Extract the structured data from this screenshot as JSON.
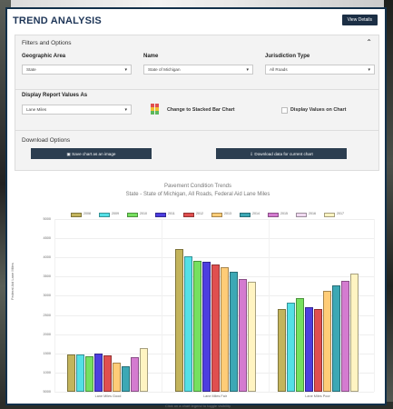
{
  "header": {
    "title": "TREND ANALYSIS",
    "view_details": "View Details"
  },
  "filters": {
    "heading": "Filters and Options",
    "geo_label": "Geographic Area",
    "geo_value": "State",
    "name_label": "Name",
    "name_value": "State of Michigan",
    "juris_label": "Jurisdiction Type",
    "juris_value": "All Roads",
    "report_label": "Display Report Values As",
    "report_value": "Lane Miles",
    "stacked_label": "Change to Stacked Bar Chart",
    "display_values_label": "Display Values on Chart",
    "download_heading": "Download Options",
    "save_image": "Save chart as an image",
    "download_data": "Download data for current chart"
  },
  "chart_data": {
    "type": "bar",
    "title": "Pavement Condition Trends",
    "subtitle": "State - State of Michigan, All Roads, Federal Aid Lane Miles",
    "ylabel": "Federal Aid Lane Miles",
    "xlabel": "",
    "note": "Click on a chart legend to toggle visibility",
    "categories": [
      "Lane Miles Good",
      "Lane Miles Fair",
      "Lane Miles Poor"
    ],
    "ylim": [
      0,
      6000
    ],
    "yticks": [
      "5000",
      "4500",
      "4000",
      "3500",
      "3000",
      "2500",
      "2000",
      "1500",
      "1000",
      "5000"
    ],
    "series": [
      {
        "name": "2008",
        "color": "#c3b45c",
        "values": [
          1290,
          4950,
          2880
        ]
      },
      {
        "name": "2009",
        "color": "#54e0e6",
        "values": [
          1310,
          4700,
          3100
        ]
      },
      {
        "name": "2010",
        "color": "#76e05f",
        "values": [
          1230,
          4560,
          3250
        ]
      },
      {
        "name": "2011",
        "color": "#4d3ee0",
        "values": [
          1330,
          4520,
          2950
        ]
      },
      {
        "name": "2012",
        "color": "#e04f4f",
        "values": [
          1250,
          4420,
          2880
        ]
      },
      {
        "name": "2013",
        "color": "#ffcc77",
        "values": [
          1000,
          4320,
          3500
        ]
      },
      {
        "name": "2014",
        "color": "#3ca8b5",
        "values": [
          870,
          4160,
          3700
        ]
      },
      {
        "name": "2015",
        "color": "#d47bd0",
        "values": [
          1210,
          3920,
          3860
        ]
      },
      {
        "name": "2016",
        "color": "#fff4c2",
        "values": [
          1530,
          3820,
          4100
        ]
      }
    ],
    "legend": [
      {
        "name": "2008",
        "color": "#c3b45c"
      },
      {
        "name": "2009",
        "color": "#54e0e6"
      },
      {
        "name": "2010",
        "color": "#76e05f"
      },
      {
        "name": "2011",
        "color": "#4d3ee0"
      },
      {
        "name": "2012",
        "color": "#e04f4f"
      },
      {
        "name": "2013",
        "color": "#ffcc77"
      },
      {
        "name": "2014",
        "color": "#3ca8b5"
      },
      {
        "name": "2015",
        "color": "#d47bd0"
      },
      {
        "name": "2016",
        "color": "#f0d9f0"
      },
      {
        "name": "2017",
        "color": "#fff4c2"
      }
    ]
  }
}
